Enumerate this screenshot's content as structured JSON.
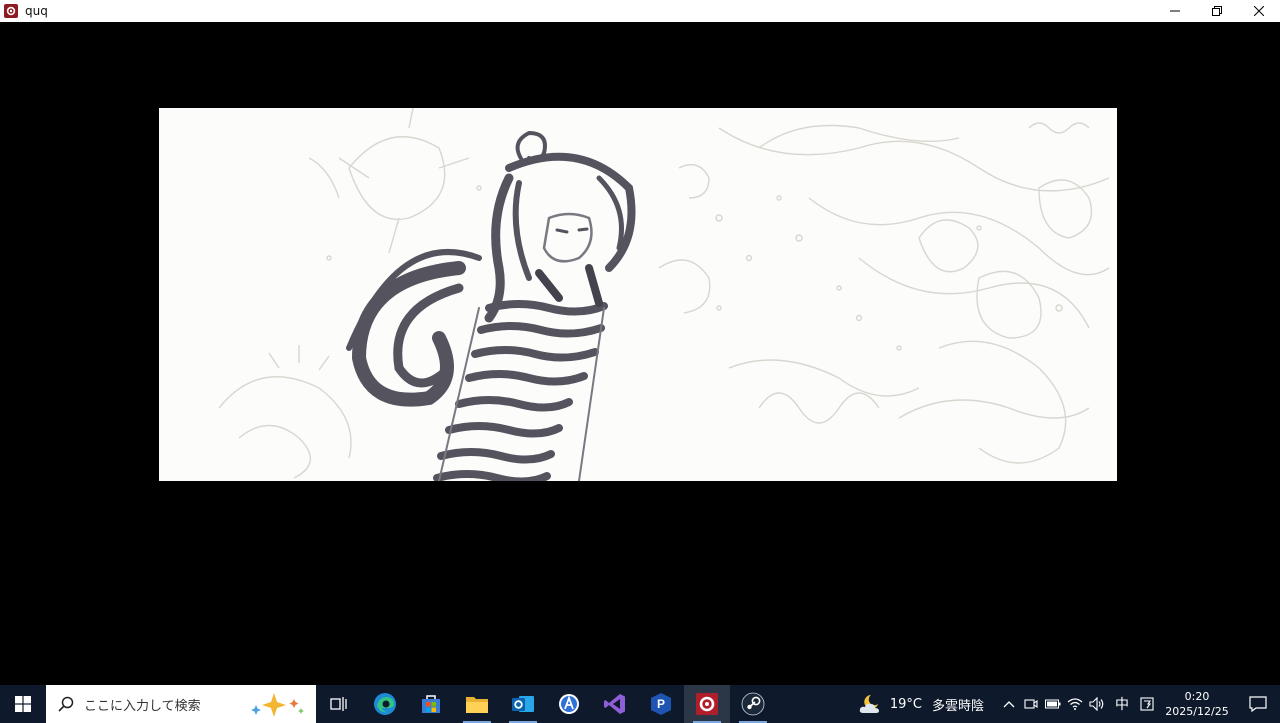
{
  "window": {
    "title": "quq",
    "accent": "#8e1b22",
    "controls": [
      "minimize",
      "restore",
      "close"
    ]
  },
  "content": {
    "background": "#000000",
    "image_description_icon": "ink-sketch-artwork"
  },
  "taskbar": {
    "search": {
      "placeholder": "ここに入力して検索"
    },
    "apps": [
      {
        "name": "task-view",
        "icon": "task-view-icon"
      },
      {
        "name": "edge",
        "icon": "edge-icon"
      },
      {
        "name": "store",
        "icon": "store-icon"
      },
      {
        "name": "file-explorer",
        "icon": "folder-icon"
      },
      {
        "name": "outlook",
        "icon": "outlook-icon"
      },
      {
        "name": "app-a",
        "icon": "a-app-icon"
      },
      {
        "name": "visual-studio",
        "icon": "visual-studio-icon"
      },
      {
        "name": "app-p",
        "icon": "p-app-icon"
      },
      {
        "name": "quq",
        "icon": "quq-icon",
        "active": true
      },
      {
        "name": "steam",
        "icon": "steam-icon"
      }
    ],
    "weather": {
      "temp": "19°C",
      "condition": "多雲時陰"
    },
    "ime": "中",
    "clock": {
      "time": "0:20",
      "date": "2025/12/25"
    }
  }
}
